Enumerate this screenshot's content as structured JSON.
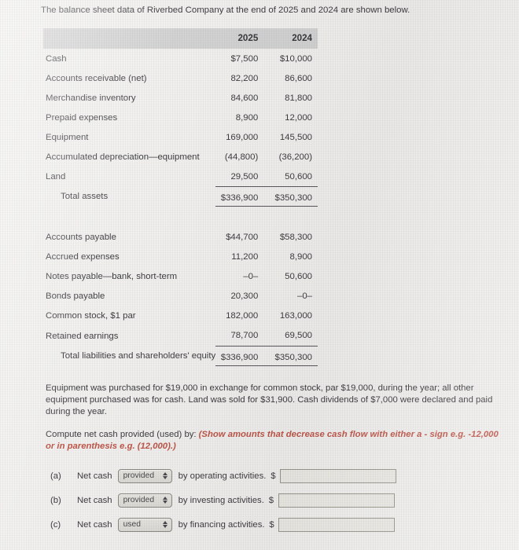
{
  "intro": "The balance sheet data of Riverbed Company at the end of 2025 and 2024 are shown below.",
  "table": {
    "headers": {
      "label": "",
      "year1": "2025",
      "year2": "2024"
    },
    "assets": [
      {
        "label": "Cash",
        "y1": "$7,500",
        "y2": "$10,000"
      },
      {
        "label": "Accounts receivable (net)",
        "y1": "82,200",
        "y2": "86,600"
      },
      {
        "label": "Merchandise inventory",
        "y1": "84,600",
        "y2": "81,800"
      },
      {
        "label": "Prepaid expenses",
        "y1": "8,900",
        "y2": "12,000"
      },
      {
        "label": "Equipment",
        "y1": "169,000",
        "y2": "145,500"
      },
      {
        "label": "Accumulated depreciation—equipment",
        "y1": "(44,800)",
        "y2": "(36,200)"
      },
      {
        "label": "Land",
        "y1": "29,500",
        "y2": "50,600"
      }
    ],
    "assets_total": {
      "label": "Total assets",
      "y1": "$336,900",
      "y2": "$350,300"
    },
    "liabilities": [
      {
        "label": "Accounts payable",
        "y1": "$44,700",
        "y2": "$58,300"
      },
      {
        "label": "Accrued expenses",
        "y1": "11,200",
        "y2": "8,900"
      },
      {
        "label": "Notes payable—bank, short-term",
        "y1": "–0–",
        "y2": "50,600"
      },
      {
        "label": "Bonds payable",
        "y1": "20,300",
        "y2": "–0–"
      },
      {
        "label": "Common stock, $1 par",
        "y1": "182,000",
        "y2": "163,000"
      },
      {
        "label": "Retained earnings",
        "y1": "78,700",
        "y2": "69,500"
      }
    ],
    "liabilities_total": {
      "label": "Total liabilities and shareholders' equity",
      "y1": "$336,900",
      "y2": "$350,300"
    }
  },
  "note": "Equipment was purchased for $19,000 in exchange for common stock, par $19,000, during the year; all other equipment purchased was for cash. Land was sold for $31,900. Cash dividends of $7,000 were declared and paid during the year.",
  "compute": {
    "lead": "Compute net cash provided (used) by:",
    "hint": "(Show amounts that decrease cash flow with either a - sign e.g. -12,000 or in parenthesis e.g. (12,000).)"
  },
  "answers": {
    "dollar_sign": "$",
    "rows": [
      {
        "letter": "(a)",
        "pre": "Net cash",
        "select_value": "provided",
        "post": "by operating activities.",
        "amount": ""
      },
      {
        "letter": "(b)",
        "pre": "Net cash",
        "select_value": "provided",
        "post": "by investing activities.",
        "amount": ""
      },
      {
        "letter": "(c)",
        "pre": "Net cash",
        "select_value": "used",
        "post": "by financing activities.",
        "amount": ""
      }
    ]
  },
  "colors": {
    "background": "#f1f0ee",
    "header_band": "#d3d3d3",
    "text": "#3e3e42",
    "hint_red": "#c0564a",
    "rule": "#5a5a5e"
  }
}
